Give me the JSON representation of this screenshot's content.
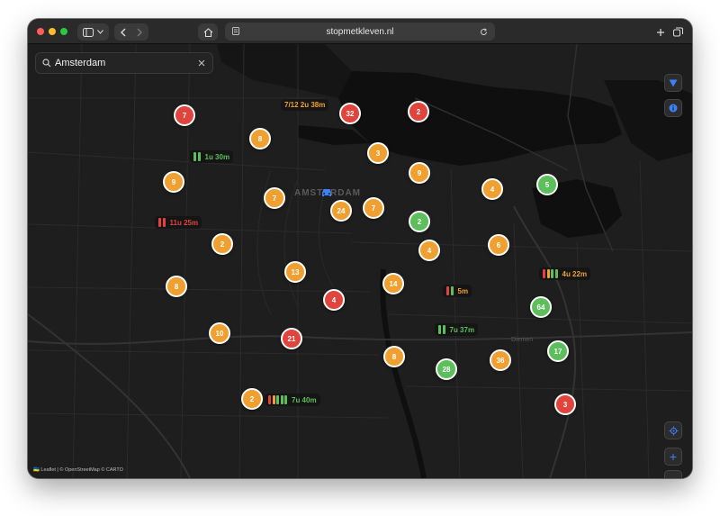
{
  "browser": {
    "url": "stopmetkleven.nl",
    "icons": {
      "sidebar": "sidebar-icon",
      "back": "chevron-left-icon",
      "forward": "chevron-right-icon",
      "home": "home-icon",
      "site": "site-icon",
      "reload": "reload-icon",
      "new_tab": "plus-icon",
      "tabs": "tabs-icon"
    }
  },
  "search": {
    "value": "Amsterdam",
    "icon": "search-icon",
    "clear_icon": "close-icon"
  },
  "map_labels": {
    "city": "AMSTERDAM",
    "suburb": "Diemen"
  },
  "controls": {
    "filter_icon": "filter-icon",
    "info_icon": "info-icon",
    "locate_icon": "locate-icon",
    "zoom_in": "+",
    "zoom_out": "−"
  },
  "colors": {
    "red": "#e0443c",
    "orange": "#f0a030",
    "green": "#5cbf5c",
    "accent": "#3b82f6"
  },
  "markers": [
    {
      "count": "7",
      "color": "red"
    },
    {
      "count": "32",
      "color": "red"
    },
    {
      "count": "2",
      "color": "red"
    },
    {
      "count": "8",
      "color": "orange"
    },
    {
      "count": "3",
      "color": "orange"
    },
    {
      "count": "9",
      "color": "orange"
    },
    {
      "count": "9",
      "color": "orange"
    },
    {
      "count": "4",
      "color": "orange"
    },
    {
      "count": "5",
      "color": "green"
    },
    {
      "count": "7",
      "color": "orange"
    },
    {
      "count": "24",
      "color": "orange"
    },
    {
      "count": "7",
      "color": "orange"
    },
    {
      "count": "2",
      "color": "green"
    },
    {
      "count": "2",
      "color": "orange"
    },
    {
      "count": "4",
      "color": "orange"
    },
    {
      "count": "6",
      "color": "orange"
    },
    {
      "count": "13",
      "color": "orange"
    },
    {
      "count": "14",
      "color": "orange"
    },
    {
      "count": "8",
      "color": "orange"
    },
    {
      "count": "4",
      "color": "red"
    },
    {
      "count": "64",
      "color": "green"
    },
    {
      "count": "10",
      "color": "orange"
    },
    {
      "count": "21",
      "color": "red"
    },
    {
      "count": "8",
      "color": "orange"
    },
    {
      "count": "28",
      "color": "green"
    },
    {
      "count": "36",
      "color": "orange"
    },
    {
      "count": "17",
      "color": "green"
    },
    {
      "count": "2",
      "color": "orange"
    },
    {
      "count": "3",
      "color": "red"
    }
  ],
  "durations": [
    {
      "text": "7/12  2u 38m",
      "color": "orange",
      "bars": []
    },
    {
      "text": "1u 30m",
      "color": "green",
      "bars": [
        "green",
        "green"
      ]
    },
    {
      "text": "11u 25m",
      "color": "red",
      "bars": [
        "red",
        "red"
      ]
    },
    {
      "text": "4u 22m",
      "color": "orange",
      "bars": [
        "red",
        "orange",
        "green",
        "green"
      ]
    },
    {
      "text": "5m",
      "color": "orange",
      "bars": [
        "red",
        "green"
      ]
    },
    {
      "text": "7u 37m",
      "color": "green",
      "bars": [
        "green",
        "green"
      ]
    },
    {
      "text": "7u 40m",
      "color": "green",
      "bars": [
        "red",
        "orange",
        "green",
        "green",
        "green"
      ]
    }
  ],
  "attribution": {
    "flag": "🇺🇦",
    "text": "Leaflet | © OpenStreetMap © CARTO"
  }
}
